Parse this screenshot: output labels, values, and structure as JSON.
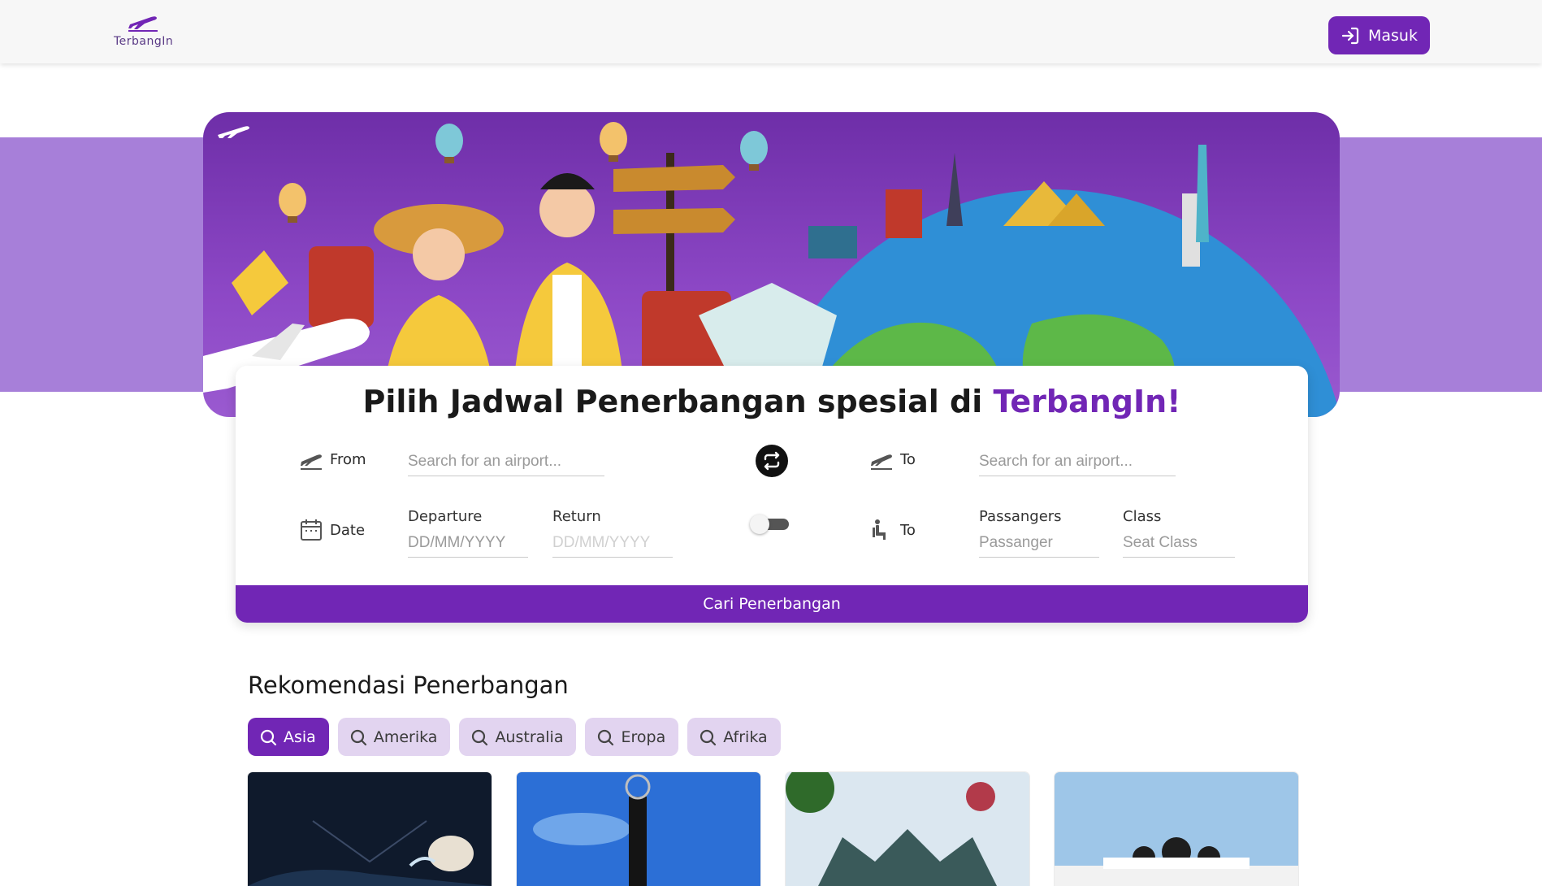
{
  "header": {
    "logo_text": "TerbangIn",
    "login_label": "Masuk",
    "login_icon": "login-arrow-icon",
    "logo_icon": "airplane-takeoff-icon"
  },
  "hero": {
    "description_icons": [
      "airplane-icon",
      "hot-air-balloon-icon",
      "suitcase-icon",
      "signpost-icon",
      "globe-icon"
    ]
  },
  "search": {
    "title_prefix": "Pilih Jadwal Penerbangan spesial di ",
    "title_brand": "TerbangIn!",
    "from_label": "From",
    "from_placeholder": "Search for an airport...",
    "to_label": "To",
    "to_placeholder": "Search for an airport...",
    "date_label": "Date",
    "departure_label": "Departure",
    "departure_placeholder": "DD/MM/YYYY",
    "return_label": "Return",
    "return_placeholder": "DD/MM/YYYY",
    "seat_label": "To",
    "passengers_label": "Passangers",
    "passengers_placeholder": "Passanger",
    "class_label": "Class",
    "class_placeholder": "Seat Class",
    "round_trip_enabled": false,
    "submit_label": "Cari Penerbangan"
  },
  "recommendations": {
    "title": "Rekomendasi Penerbangan",
    "filters": [
      {
        "label": "Asia",
        "active": true
      },
      {
        "label": "Amerika",
        "active": false
      },
      {
        "label": "Australia",
        "active": false
      },
      {
        "label": "Eropa",
        "active": false
      },
      {
        "label": "Afrika",
        "active": false
      }
    ]
  },
  "colors": {
    "primary": "#7126b5",
    "hero_band": "#a77fd9",
    "chip_inactive": "#e2d4f0"
  }
}
